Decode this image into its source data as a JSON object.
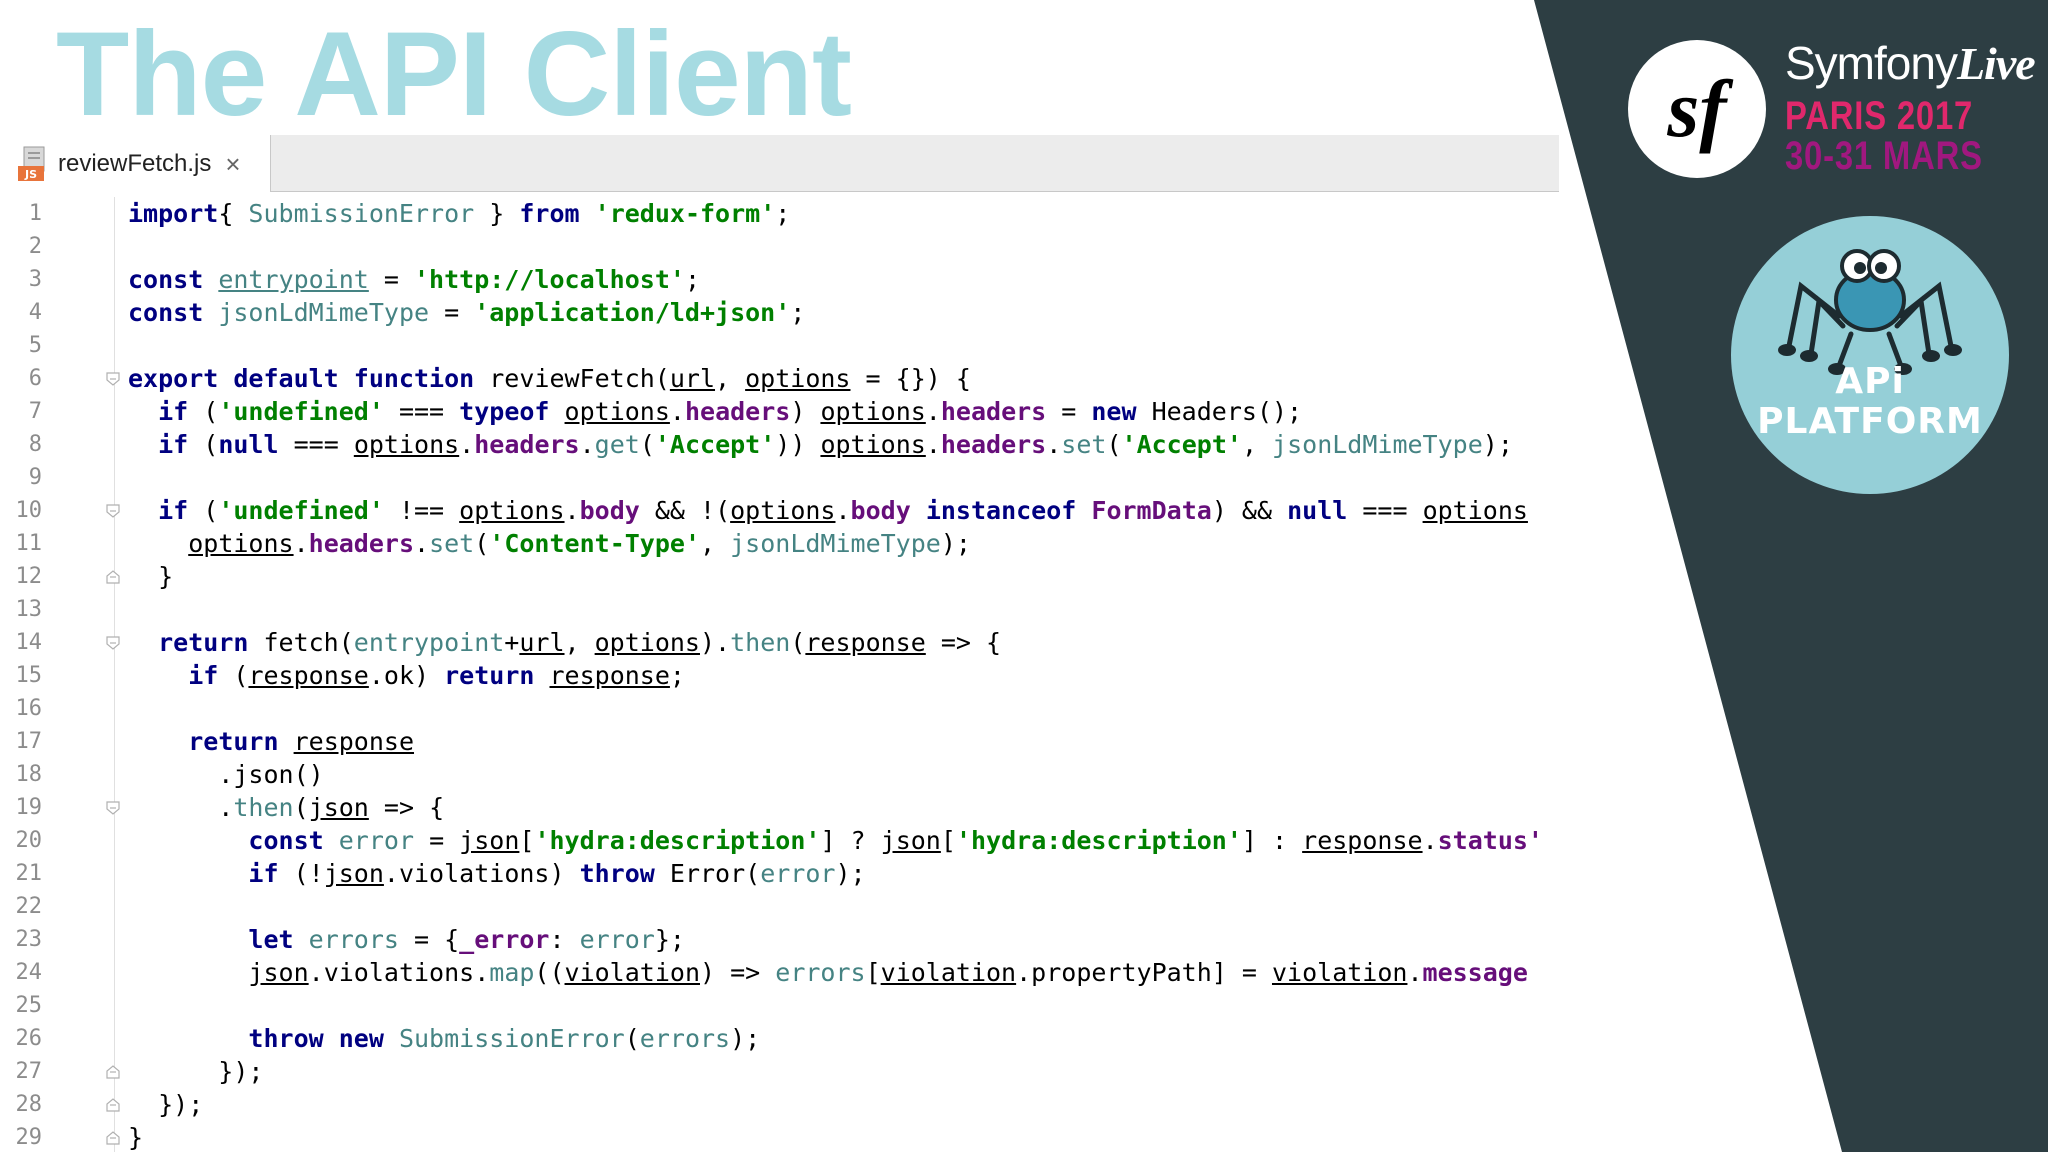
{
  "slide": {
    "title": "The API Client"
  },
  "branding": {
    "sf_glyph": "sf",
    "brand_name": "Symfony",
    "brand_live": "Live",
    "event_city": "PARIS 2017",
    "event_dates": "30-31 MARS",
    "api_platform_line1": "APi",
    "api_platform_line2": "PLATFORM",
    "colors": {
      "accent_pink": "#e0286c",
      "accent_purple": "#a1187f",
      "panel": "#2d3e43",
      "badge": "#95cfd7",
      "title": "#a6dbe2"
    }
  },
  "editor": {
    "tab": {
      "filename": "reviewFetch.js",
      "close_glyph": "×",
      "icon_badge": "JS"
    },
    "lines": [
      {
        "n": "1",
        "segs": [
          [
            "kw",
            "import"
          ],
          [
            "",
            "{ "
          ],
          [
            "gr",
            "SubmissionError"
          ],
          [
            "",
            " } "
          ],
          [
            "kw",
            "from"
          ],
          [
            "",
            " "
          ],
          [
            "str",
            "'redux-form'"
          ],
          [
            "",
            ";"
          ]
        ]
      },
      {
        "n": "2",
        "segs": []
      },
      {
        "n": "3",
        "segs": [
          [
            "kw",
            "const"
          ],
          [
            "",
            " "
          ],
          [
            "gr ul",
            "entrypoint"
          ],
          [
            "",
            " = "
          ],
          [
            "str",
            "'http://localhost'"
          ],
          [
            "",
            ";"
          ]
        ]
      },
      {
        "n": "4",
        "segs": [
          [
            "kw",
            "const"
          ],
          [
            "",
            " "
          ],
          [
            "gr",
            "jsonLdMimeType"
          ],
          [
            "",
            " = "
          ],
          [
            "str",
            "'application/ld+json'"
          ],
          [
            "",
            ";"
          ]
        ]
      },
      {
        "n": "5",
        "segs": []
      },
      {
        "n": "6",
        "fold": "open",
        "segs": [
          [
            "kw",
            "export default function"
          ],
          [
            "",
            " reviewFetch("
          ],
          [
            "ul",
            "url"
          ],
          [
            "",
            ", "
          ],
          [
            "ul",
            "options"
          ],
          [
            "",
            " = {}) {"
          ]
        ]
      },
      {
        "n": "7",
        "segs": [
          [
            "",
            "  "
          ],
          [
            "kw",
            "if"
          ],
          [
            "",
            " ("
          ],
          [
            "str",
            "'undefined'"
          ],
          [
            "",
            " === "
          ],
          [
            "kw",
            "typeof"
          ],
          [
            "",
            " "
          ],
          [
            "ul",
            "options"
          ],
          [
            "",
            "."
          ],
          [
            "fld",
            "headers"
          ],
          [
            "",
            ") "
          ],
          [
            "ul",
            "options"
          ],
          [
            "",
            "."
          ],
          [
            "fld",
            "headers"
          ],
          [
            "",
            " = "
          ],
          [
            "kw",
            "new"
          ],
          [
            "",
            " Headers();"
          ]
        ]
      },
      {
        "n": "8",
        "segs": [
          [
            "",
            "  "
          ],
          [
            "kw",
            "if"
          ],
          [
            "",
            " ("
          ],
          [
            "kw",
            "null"
          ],
          [
            "",
            " === "
          ],
          [
            "ul",
            "options"
          ],
          [
            "",
            "."
          ],
          [
            "fld",
            "headers"
          ],
          [
            "",
            "."
          ],
          [
            "gr",
            "get"
          ],
          [
            "",
            "("
          ],
          [
            "str",
            "'Accept'"
          ],
          [
            "",
            ")) "
          ],
          [
            "ul",
            "options"
          ],
          [
            "",
            "."
          ],
          [
            "fld",
            "headers"
          ],
          [
            "",
            "."
          ],
          [
            "gr",
            "set"
          ],
          [
            "",
            "("
          ],
          [
            "str",
            "'Accept'"
          ],
          [
            "",
            ", "
          ],
          [
            "gr",
            "jsonLdMimeType"
          ],
          [
            "",
            ");"
          ]
        ]
      },
      {
        "n": "9",
        "segs": []
      },
      {
        "n": "10",
        "fold": "open",
        "segs": [
          [
            "",
            "  "
          ],
          [
            "kw",
            "if"
          ],
          [
            "",
            " ("
          ],
          [
            "str",
            "'undefined'"
          ],
          [
            "",
            " !== "
          ],
          [
            "ul",
            "options"
          ],
          [
            "",
            "."
          ],
          [
            "fld",
            "body"
          ],
          [
            "",
            " && !("
          ],
          [
            "ul",
            "options"
          ],
          [
            "",
            "."
          ],
          [
            "fld",
            "body"
          ],
          [
            "",
            " "
          ],
          [
            "kw",
            "instanceof"
          ],
          [
            "",
            " "
          ],
          [
            "fld",
            "FormData"
          ],
          [
            "",
            ") && "
          ],
          [
            "kw",
            "null"
          ],
          [
            "",
            " === "
          ],
          [
            "ul",
            "options"
          ]
        ]
      },
      {
        "n": "11",
        "segs": [
          [
            "",
            "    "
          ],
          [
            "ul",
            "options"
          ],
          [
            "",
            "."
          ],
          [
            "fld",
            "headers"
          ],
          [
            "",
            "."
          ],
          [
            "gr",
            "set"
          ],
          [
            "",
            "("
          ],
          [
            "str",
            "'Content-Type'"
          ],
          [
            "",
            ", "
          ],
          [
            "gr",
            "jsonLdMimeType"
          ],
          [
            "",
            ");"
          ]
        ]
      },
      {
        "n": "12",
        "fold": "close",
        "segs": [
          [
            "",
            "  }"
          ]
        ]
      },
      {
        "n": "13",
        "segs": []
      },
      {
        "n": "14",
        "fold": "open",
        "segs": [
          [
            "",
            "  "
          ],
          [
            "kw",
            "return"
          ],
          [
            "",
            " fetch("
          ],
          [
            "gr",
            "entrypoint"
          ],
          [
            "",
            "+"
          ],
          [
            "ul",
            "url"
          ],
          [
            "",
            ", "
          ],
          [
            "ul",
            "options"
          ],
          [
            "",
            ")."
          ],
          [
            "gr",
            "then"
          ],
          [
            "",
            "("
          ],
          [
            "ul",
            "response"
          ],
          [
            "",
            " => {"
          ]
        ]
      },
      {
        "n": "15",
        "segs": [
          [
            "",
            "    "
          ],
          [
            "kw",
            "if"
          ],
          [
            "",
            " ("
          ],
          [
            "ul",
            "response"
          ],
          [
            "",
            ".ok) "
          ],
          [
            "kw",
            "return"
          ],
          [
            "",
            " "
          ],
          [
            "ul",
            "response"
          ],
          [
            "",
            ";"
          ]
        ]
      },
      {
        "n": "16",
        "segs": []
      },
      {
        "n": "17",
        "segs": [
          [
            "",
            "    "
          ],
          [
            "kw",
            "return"
          ],
          [
            "",
            " "
          ],
          [
            "ul",
            "response"
          ]
        ]
      },
      {
        "n": "18",
        "segs": [
          [
            "",
            "      .json()"
          ]
        ]
      },
      {
        "n": "19",
        "fold": "open",
        "segs": [
          [
            "",
            "      ."
          ],
          [
            "gr",
            "then"
          ],
          [
            "",
            "("
          ],
          [
            "ul",
            "json"
          ],
          [
            "",
            " => {"
          ]
        ]
      },
      {
        "n": "20",
        "segs": [
          [
            "",
            "        "
          ],
          [
            "kw",
            "const"
          ],
          [
            "",
            " "
          ],
          [
            "gr",
            "error"
          ],
          [
            "",
            " = "
          ],
          [
            "ul",
            "json"
          ],
          [
            "",
            "["
          ],
          [
            "str",
            "'hydra:description'"
          ],
          [
            "",
            "] ? "
          ],
          [
            "ul",
            "json"
          ],
          [
            "",
            "["
          ],
          [
            "str",
            "'hydra:description'"
          ],
          [
            "",
            "] : "
          ],
          [
            "ul",
            "response"
          ],
          [
            "",
            "."
          ],
          [
            "fld",
            "status'"
          ]
        ]
      },
      {
        "n": "21",
        "segs": [
          [
            "",
            "        "
          ],
          [
            "kw",
            "if"
          ],
          [
            "",
            " (!"
          ],
          [
            "ul",
            "json"
          ],
          [
            "",
            ".violations) "
          ],
          [
            "kw",
            "throw"
          ],
          [
            "",
            " Error("
          ],
          [
            "gr",
            "error"
          ],
          [
            "",
            ");"
          ]
        ]
      },
      {
        "n": "22",
        "segs": []
      },
      {
        "n": "23",
        "segs": [
          [
            "",
            "        "
          ],
          [
            "kw",
            "let"
          ],
          [
            "",
            " "
          ],
          [
            "gr",
            "errors"
          ],
          [
            "",
            " = {"
          ],
          [
            "fld",
            "_error"
          ],
          [
            "",
            ": "
          ],
          [
            "gr",
            "error"
          ],
          [
            "",
            "};"
          ]
        ]
      },
      {
        "n": "24",
        "segs": [
          [
            "",
            "        "
          ],
          [
            "ul",
            "json"
          ],
          [
            "",
            ".violations."
          ],
          [
            "gr",
            "map"
          ],
          [
            "",
            "(("
          ],
          [
            "ul",
            "violation"
          ],
          [
            "",
            ") => "
          ],
          [
            "gr",
            "errors"
          ],
          [
            "",
            "["
          ],
          [
            "ul",
            "violation"
          ],
          [
            "",
            ".propertyPath] = "
          ],
          [
            "ul",
            "violation"
          ],
          [
            "",
            "."
          ],
          [
            "fld",
            "message"
          ]
        ]
      },
      {
        "n": "25",
        "segs": []
      },
      {
        "n": "26",
        "segs": [
          [
            "",
            "        "
          ],
          [
            "kw",
            "throw new"
          ],
          [
            "",
            " "
          ],
          [
            "gr",
            "SubmissionError"
          ],
          [
            "",
            "("
          ],
          [
            "gr",
            "errors"
          ],
          [
            "",
            ");"
          ]
        ]
      },
      {
        "n": "27",
        "fold": "close",
        "segs": [
          [
            "",
            "      });"
          ]
        ]
      },
      {
        "n": "28",
        "fold": "close",
        "segs": [
          [
            "",
            "  });"
          ]
        ]
      },
      {
        "n": "29",
        "fold": "close",
        "segs": [
          [
            "",
            "}"
          ]
        ]
      }
    ]
  }
}
